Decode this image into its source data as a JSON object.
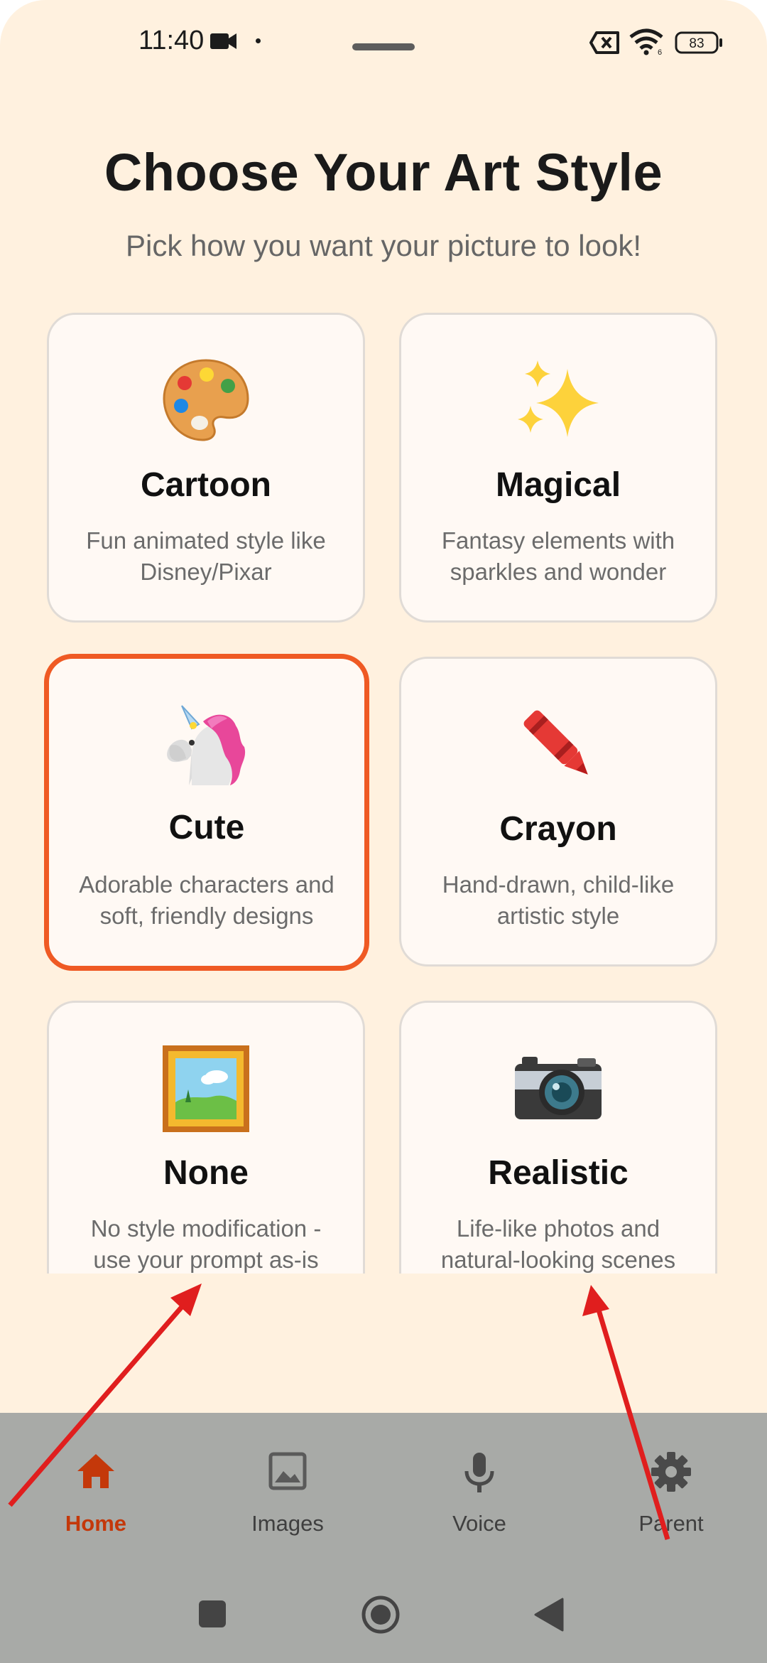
{
  "status_bar": {
    "time": "11:40",
    "battery": "83"
  },
  "header": {
    "title": "Choose Your Art Style",
    "subtitle": "Pick how you want your picture to look!"
  },
  "styles": [
    {
      "name": "Cartoon",
      "description": "Fun animated style like Disney/Pixar",
      "icon": "palette-icon",
      "selected": false
    },
    {
      "name": "Magical",
      "description": "Fantasy elements with sparkles and wonder",
      "icon": "sparkles-icon",
      "selected": false
    },
    {
      "name": "Cute",
      "description": "Adorable characters and soft, friendly designs",
      "icon": "unicorn-icon",
      "selected": true
    },
    {
      "name": "Crayon",
      "description": "Hand-drawn, child-like artistic style",
      "icon": "crayon-icon",
      "selected": false
    },
    {
      "name": "None",
      "description": "No style modification - use your prompt as-is",
      "icon": "framed-picture-icon",
      "selected": false
    },
    {
      "name": "Realistic",
      "description": "Life-like photos and natural-looking scenes",
      "icon": "camera-icon",
      "selected": false
    }
  ],
  "bottom_nav": {
    "items": [
      {
        "label": "Home",
        "icon": "home-icon",
        "active": true
      },
      {
        "label": "Images",
        "icon": "image-icon",
        "active": false
      },
      {
        "label": "Voice",
        "icon": "microphone-icon",
        "active": false
      },
      {
        "label": "Parent",
        "icon": "gear-icon",
        "active": false
      }
    ]
  },
  "colors": {
    "background": "#fff1df",
    "card": "#fff9f4",
    "selected_border": "#ef5a24",
    "active_nav": "#c4380a",
    "nav_bar": "#a8aaa7",
    "annotation_arrow": "#e01e1e"
  }
}
